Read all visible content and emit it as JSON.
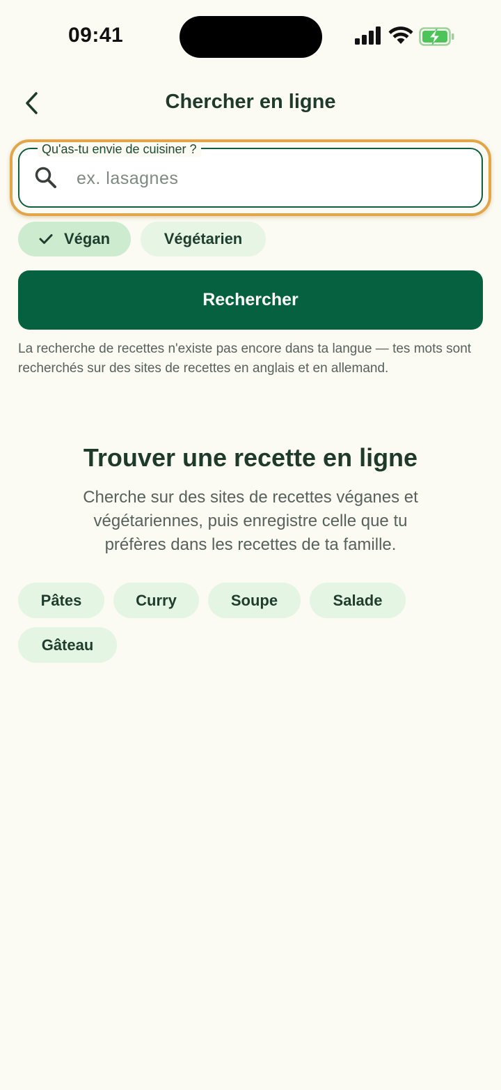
{
  "status_bar": {
    "time": "09:41",
    "icons": [
      "cellular-signal-icon",
      "wifi-icon",
      "battery-charging-icon"
    ]
  },
  "header": {
    "title": "Chercher en ligne",
    "back_icon": "chevron-left-icon"
  },
  "search": {
    "label": "Qu'as-tu envie de cuisiner ?",
    "placeholder": "ex. lasagnes",
    "value": "",
    "icon": "search-icon"
  },
  "filters": [
    {
      "label": "Végan",
      "selected": true
    },
    {
      "label": "Végétarien",
      "selected": false
    }
  ],
  "search_button": {
    "label": "Rechercher"
  },
  "note": "La recherche de recettes n'existe pas encore dans ta langue — tes mots sont recherchés sur des sites de recettes en anglais et en allemand.",
  "empty_state": {
    "title": "Trouver une recette en ligne",
    "description": "Cherche sur des sites de recettes véganes et végétariennes, puis enregistre celle que tu préfères dans les recettes de ta famille."
  },
  "suggestions": [
    "Pâtes",
    "Curry",
    "Soupe",
    "Salade",
    "Gâteau"
  ],
  "colors": {
    "background": "#fbfaf3",
    "primary": "#05613f",
    "focus_ring": "#e3a54a",
    "chip_selected": "#cdeccf",
    "chip": "#e6f5e4"
  }
}
